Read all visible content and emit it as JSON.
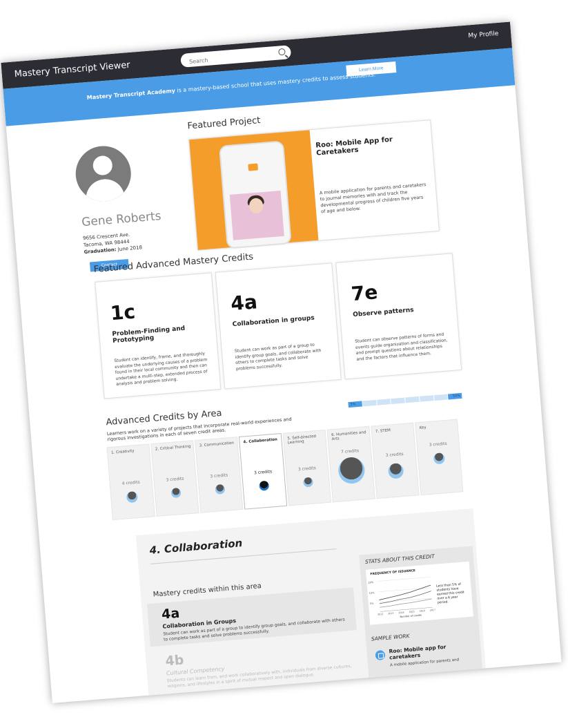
{
  "header": {
    "app_title": "Mastery Transcript Viewer",
    "profile_link": "My Profile",
    "search_placeholder": "Search"
  },
  "banner": {
    "school_name": "Mastery Transcript Academy",
    "tagline_rest": " is a mastery-based school that uses mastery credits to assess students.",
    "learn_more": "Learn More"
  },
  "student": {
    "name": "Gene Roberts",
    "address_line1": "9656 Crescent Ave.",
    "address_line2": "Tacoma, WA 98444",
    "graduation_label": "Graduation:",
    "graduation_value": "June 2018",
    "contact_label": "Contact"
  },
  "featured_project": {
    "heading": "Featured Project",
    "title": "Roo: Mobile App for Caretakers",
    "description": "A mobile application for parents and caretakers to journal memories with and track the developmental progress of children five years of age and below."
  },
  "featured_credits": {
    "heading": "Featured Advanced Mastery Credits",
    "items": [
      {
        "code": "1c",
        "name": "Problem-Finding and Prototyping",
        "description": "Student can identify, frame, and thoroughly evaluate the underlying causes of a problem found in their local community and then can undertake a multi-step, extended process of analysis and problem solving."
      },
      {
        "code": "4a",
        "name": "Collaboration in groups",
        "description": "Student can work as part of a group to identify group goals, and collaborate with others to complete tasks and solve problems successfully."
      },
      {
        "code": "7e",
        "name": "Observe patterns",
        "description": "Student can observe patterns of forms and events guide organization and classification, and prompt questions about relationships and the factors that influence them."
      }
    ]
  },
  "areas": {
    "heading": "Advanced Credits by Area",
    "subtitle": "Learners work on a variety of projects that incorporate real-world experiences and rigorous investigations in each of seven credit areas.",
    "progress_start": "5%",
    "progress_end": "50%",
    "progress_value_pct": 50,
    "items": [
      {
        "name": "1. Creativity",
        "count": "4 credits",
        "size": 16
      },
      {
        "name": "2. Critical Thinking",
        "count": "3 credits",
        "size": 14
      },
      {
        "name": "3. Communication",
        "count": "3 credits",
        "size": 14
      },
      {
        "name": "4. Collaboration",
        "count": "3 credits",
        "size": 14
      },
      {
        "name": "5. Self-directed Learning",
        "count": "3 credits",
        "size": 14
      },
      {
        "name": "6. Humanities and Arts",
        "count": "7 credits",
        "size": 38
      },
      {
        "name": "7. STEM",
        "count": "3 credits",
        "size": 22
      },
      {
        "name": "Key",
        "count": "3 credits",
        "size": 16
      }
    ]
  },
  "detail": {
    "title": "4. Collaboration",
    "mastery_heading": "Mastery credits within this area",
    "credits": [
      {
        "code": "4a",
        "name": "Collaboration in Groups",
        "description": "Student can work as part of a group to identify group goals, and collaborate with others to complete tasks and solve problems successfully."
      },
      {
        "code": "4b",
        "name": "Cultural Competency",
        "description": "Students can learn from, and work collaboratively with, individuals from diverse cultures, religions, and lifestyles in a spirit of mutual respect and open dialogue."
      }
    ],
    "stats": {
      "heading": "STATS ABOUT THIS CREDIT",
      "freq_title": "FREQUENCY OF ISSUANCE",
      "note": "Less than 5% of students have earned this credit over a 6 year period.",
      "x_title": "Number of credits",
      "y_ticks": [
        "20%",
        "10%",
        "5%"
      ],
      "x_ticks": [
        "2012",
        "2013",
        "2014",
        "2015",
        "2016",
        "2017"
      ],
      "series": [
        [
          1.5,
          1.7,
          2.0,
          2.2,
          2.6,
          3.1
        ],
        [
          2.2,
          2.5,
          2.8,
          3.2,
          3.7,
          4.2
        ],
        [
          0.8,
          0.9,
          1.1,
          1.2,
          1.4,
          1.6
        ]
      ]
    },
    "sample_work": {
      "heading": "SAMPLE WORK",
      "title": "Roo: Mobile app for caretakers",
      "description": "A mobile application for parents and"
    }
  }
}
